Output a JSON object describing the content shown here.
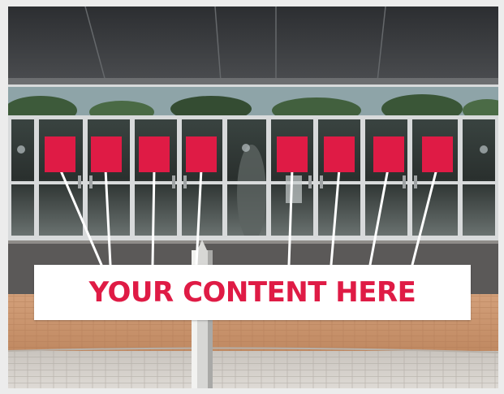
{
  "banner": {
    "text": "YOUR CONTENT HERE"
  },
  "colors": {
    "accent": "#df1b45",
    "canopy": "#3b3d40",
    "frame": "#d8dadb",
    "glass": "#2e3332",
    "sky": "#9ab0b6",
    "paving_brick": "#c8956f",
    "paving_stone": "#cfcac4",
    "walkway": "#5b5958",
    "leader_line": "#ffffff"
  },
  "scene": {
    "description_icons": [
      "rectangle-placeholder-icon"
    ],
    "placeholder_count": 8
  }
}
